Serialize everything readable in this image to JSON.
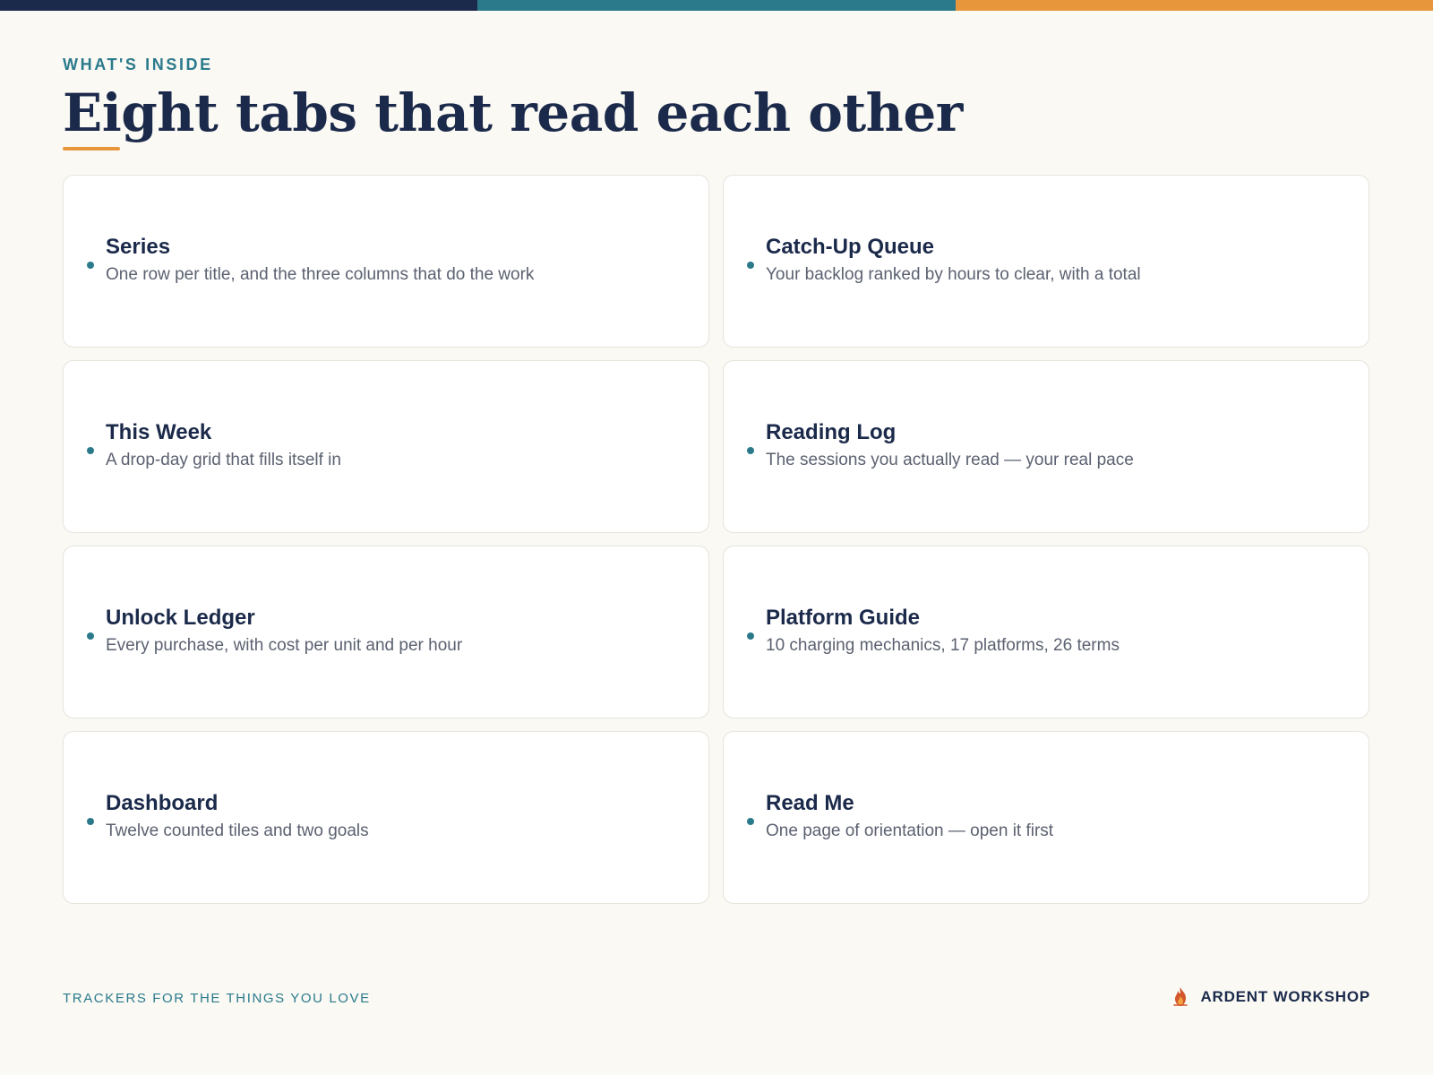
{
  "top_bar_colors": [
    "#1b2a4a",
    "#2b7a8c",
    "#e8963b"
  ],
  "header": {
    "eyebrow": "WHAT'S INSIDE",
    "title": "Eight tabs that read each other"
  },
  "tabs": [
    {
      "title": "Series",
      "description": "One row per title, and the three columns that do the work"
    },
    {
      "title": "Catch-Up Queue",
      "description": "Your backlog ranked by hours to clear, with a total"
    },
    {
      "title": "This Week",
      "description": "A drop-day grid that fills itself in"
    },
    {
      "title": "Reading Log",
      "description": "The sessions you actually read — your real pace"
    },
    {
      "title": "Unlock Ledger",
      "description": "Every purchase, with cost per unit and per hour"
    },
    {
      "title": "Platform Guide",
      "description": "10 charging mechanics, 17 platforms, 26 terms"
    },
    {
      "title": "Dashboard",
      "description": "Twelve counted tiles and two goals"
    },
    {
      "title": "Read Me",
      "description": "One page of orientation — open it first"
    }
  ],
  "footer": {
    "tagline": "TRACKERS FOR THE THINGS YOU LOVE",
    "brand_icon": "flame-icon",
    "brand_name": "ARDENT WORKSHOP"
  },
  "colors": {
    "navy": "#1b2a4a",
    "teal": "#2b7a8c",
    "orange": "#e8963b",
    "background": "#faf9f4"
  }
}
